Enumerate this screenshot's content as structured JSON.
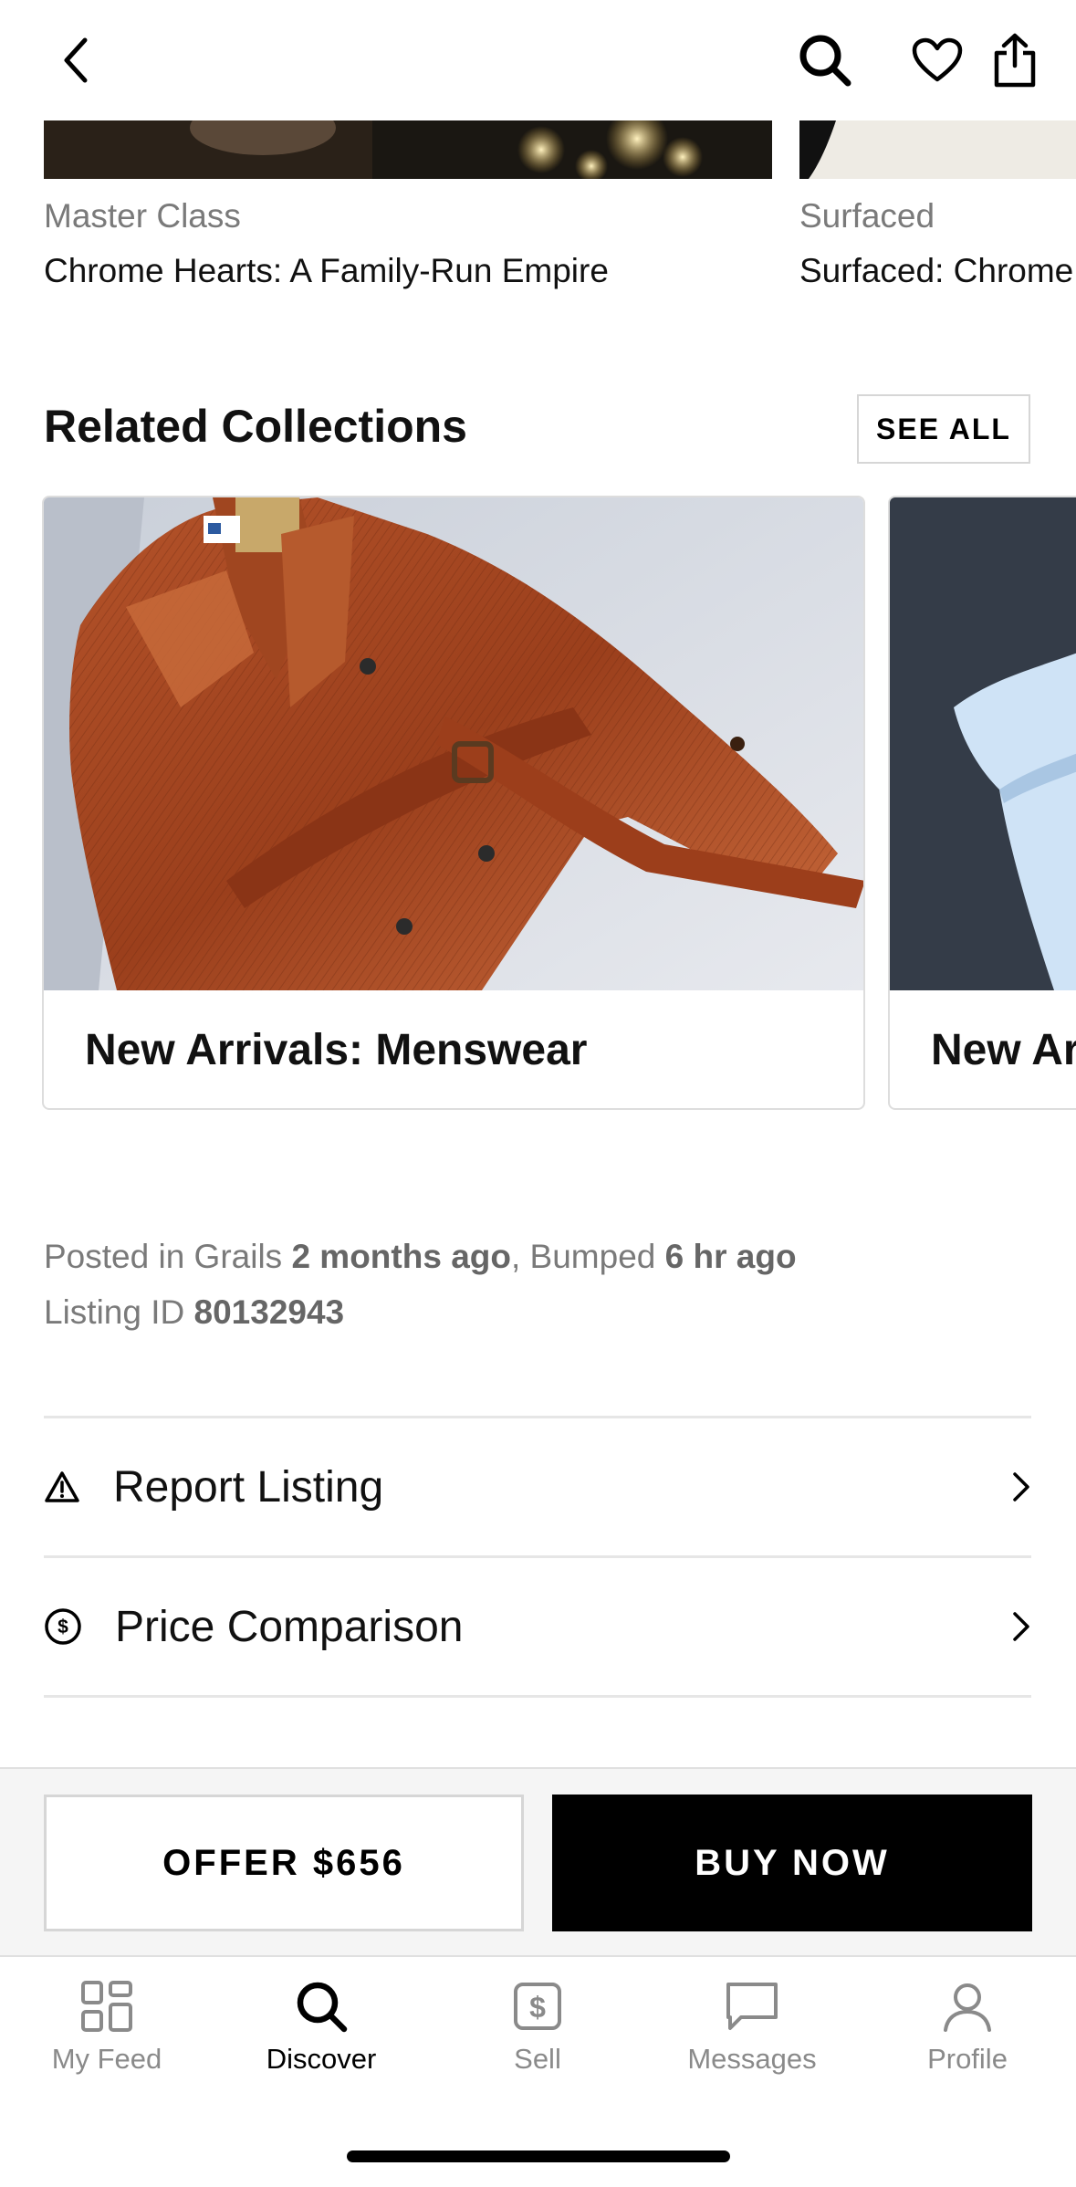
{
  "articles": [
    {
      "category": "Master Class",
      "title": "Chrome Hearts: A Family-Run Empire"
    },
    {
      "category": "Surfaced",
      "title": "Surfaced: Chrome"
    }
  ],
  "related": {
    "title": "Related Collections",
    "see_all": "SEE ALL",
    "cards": [
      {
        "title": "New Arrivals: Menswear"
      },
      {
        "title": "New Ar"
      }
    ]
  },
  "meta": {
    "posted_prefix": "Posted in Grails ",
    "posted_time": "2 months ago",
    "bumped_prefix": ", Bumped ",
    "bumped_time": "6 hr ago",
    "listing_prefix": "Listing ID ",
    "listing_id": "80132943"
  },
  "rows": [
    {
      "label": "Report Listing",
      "icon": "warning-icon"
    },
    {
      "label": "Price Comparison",
      "icon": "dollar-circle-icon"
    }
  ],
  "actions": {
    "offer": "OFFER $656",
    "buy": "BUY NOW"
  },
  "tabs": [
    {
      "label": "My Feed",
      "icon": "grid-icon",
      "active": false
    },
    {
      "label": "Discover",
      "icon": "search-icon",
      "active": true
    },
    {
      "label": "Sell",
      "icon": "dollar-tag-icon",
      "active": false
    },
    {
      "label": "Messages",
      "icon": "chat-bubble-icon",
      "active": false
    },
    {
      "label": "Profile",
      "icon": "person-icon",
      "active": false
    }
  ]
}
